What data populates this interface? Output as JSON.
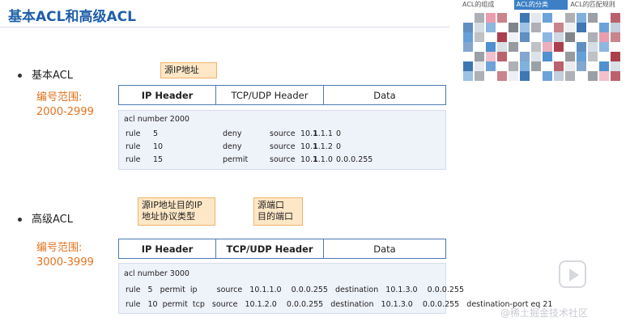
{
  "title": "基本ACL和高级ACL",
  "nav_tabs": [
    "ACL的组成",
    "ACL的分类",
    "ACL的匹配规则"
  ],
  "basic": {
    "bullet": "基本ACL",
    "range_label": "编号范围:",
    "range_value": "2000-2999",
    "callout": "源IP地址",
    "headers": [
      "IP Header",
      "TCP/UDP Header",
      "Data"
    ],
    "code_title": "acl number 2000",
    "rules": [
      {
        "k": "rule",
        "n": "5",
        "action": "deny",
        "src": "source",
        "ip_pre": "10.",
        "ip_bold": "1",
        "ip_post": ".1.1",
        "wild": "0"
      },
      {
        "k": "rule",
        "n": "10",
        "action": "deny",
        "src": "source",
        "ip_pre": "10.",
        "ip_bold": "1",
        "ip_post": ".1.2",
        "wild": "0"
      },
      {
        "k": "rule",
        "n": "15",
        "action": "permit",
        "src": "source",
        "ip_pre": "10.",
        "ip_bold": "1",
        "ip_post": ".1.0",
        "wild": "0.0.0.255"
      }
    ]
  },
  "advanced": {
    "bullet": "高级ACL",
    "range_label": "编号范围:",
    "range_value": "3000-3999",
    "callout_ip": "源IP地址目的IP\n地址协议类型",
    "callout_port": "源端口\n目的端口",
    "headers": [
      "IP Header",
      "TCP/UDP Header",
      "Data"
    ],
    "code_title": "acl number 3000",
    "rules": [
      "rule   5   permit  ip        source   10.1.1.0    0.0.0.255   destination   10.1.3.0    0.0.0.255",
      "rule   10  permit  tcp   source   10.1.2.0    0.0.0.255   destination   10.1.3.0    0.0.0.255   destination-port eq 21"
    ]
  },
  "watermark": "@稀土掘金技术社区",
  "colors": {
    "title": "#1f5fa8",
    "range": "#e2731f",
    "callout_bg": "#fde7c6",
    "code_bg": "#eef2f9",
    "border": "#4b79b2"
  }
}
